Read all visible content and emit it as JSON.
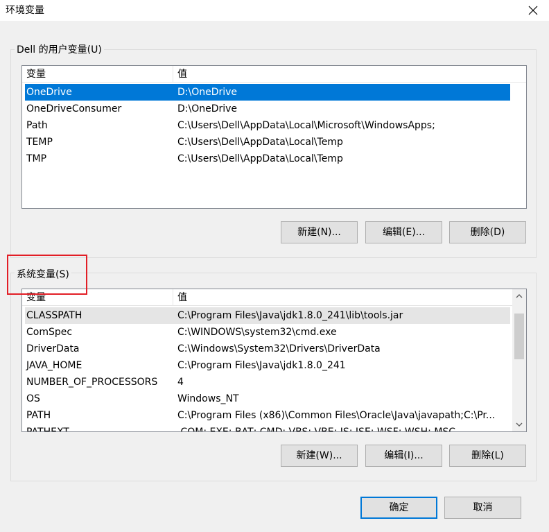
{
  "window": {
    "title": "环境变量",
    "close_icon": "close-icon"
  },
  "user_vars": {
    "group_label": "Dell 的用户变量(U)",
    "columns": [
      "变量",
      "值"
    ],
    "rows": [
      {
        "name": "OneDrive",
        "value": "D:\\OneDrive",
        "selected": true
      },
      {
        "name": "OneDriveConsumer",
        "value": "D:\\OneDrive"
      },
      {
        "name": "Path",
        "value": "C:\\Users\\Dell\\AppData\\Local\\Microsoft\\WindowsApps;"
      },
      {
        "name": "TEMP",
        "value": "C:\\Users\\Dell\\AppData\\Local\\Temp"
      },
      {
        "name": "TMP",
        "value": "C:\\Users\\Dell\\AppData\\Local\\Temp"
      }
    ],
    "buttons": {
      "new": "新建(N)...",
      "edit": "编辑(E)...",
      "delete": "删除(D)"
    }
  },
  "system_vars": {
    "group_label": "系统变量(S)",
    "columns": [
      "变量",
      "值"
    ],
    "rows": [
      {
        "name": "CLASSPATH",
        "value": "C:\\Program Files\\Java\\jdk1.8.0_241\\lib\\tools.jar",
        "hover": true
      },
      {
        "name": "ComSpec",
        "value": "C:\\WINDOWS\\system32\\cmd.exe"
      },
      {
        "name": "DriverData",
        "value": "C:\\Windows\\System32\\Drivers\\DriverData"
      },
      {
        "name": "JAVA_HOME",
        "value": "C:\\Program Files\\Java\\jdk1.8.0_241"
      },
      {
        "name": "NUMBER_OF_PROCESSORS",
        "value": "4"
      },
      {
        "name": "OS",
        "value": "Windows_NT"
      },
      {
        "name": "PATH",
        "value": "C:\\Program Files (x86)\\Common Files\\Oracle\\Java\\javapath;C:\\Pr..."
      },
      {
        "name": "PATHEXT",
        "value": ".COM;.EXE;.BAT;.CMD;.VBS;.VBE;.JS;.JSE;.WSF;.WSH;.MSC"
      }
    ],
    "scroll_position": 0.15,
    "buttons": {
      "new": "新建(W)...",
      "edit": "编辑(I)...",
      "delete": "删除(L)"
    }
  },
  "dialog_buttons": {
    "ok": "确定",
    "cancel": "取消"
  },
  "colors": {
    "selection": "#0078d7",
    "highlight_annotation": "#e21e26",
    "hover_row": "#e5e5e5"
  }
}
